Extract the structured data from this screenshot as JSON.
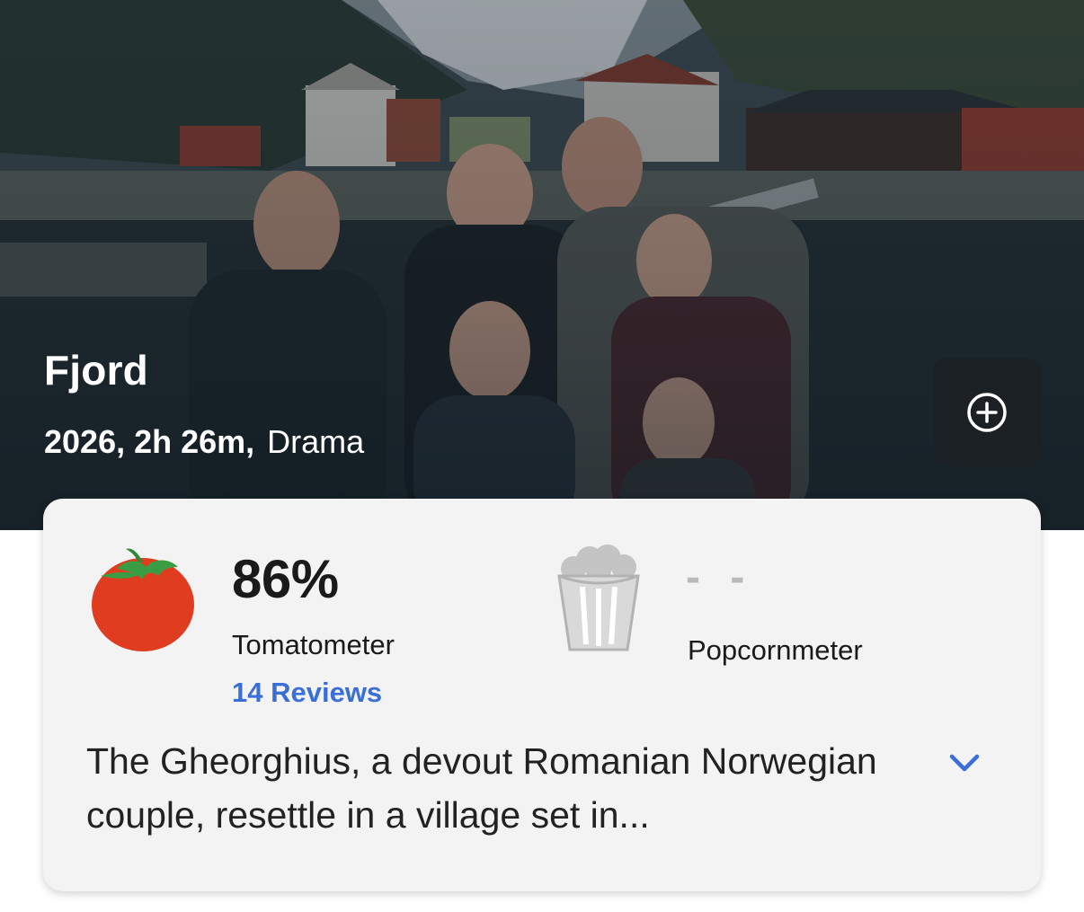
{
  "movie": {
    "title": "Fjord",
    "year_runtime": "2026, 2h 26m,",
    "genre": "Drama",
    "add_action_icon": "plus-circle-icon"
  },
  "scores": {
    "tomatometer": {
      "value": "86%",
      "label": "Tomatometer",
      "reviews_link": "14 Reviews",
      "icon": "tomato-icon",
      "color": "#e03c1f"
    },
    "popcornmeter": {
      "value": "- -",
      "label": "Popcornmeter",
      "icon": "popcorn-bucket-icon",
      "color": "#b9b9b9"
    }
  },
  "synopsis": {
    "text": "The Gheorghius, a devout Romanian Norwegian couple, resettle in a village set in...",
    "expand_icon": "chevron-down-icon"
  },
  "colors": {
    "link": "#3a6fd8",
    "card_background": "#f3f3f3",
    "button_background": "#1a2024"
  }
}
